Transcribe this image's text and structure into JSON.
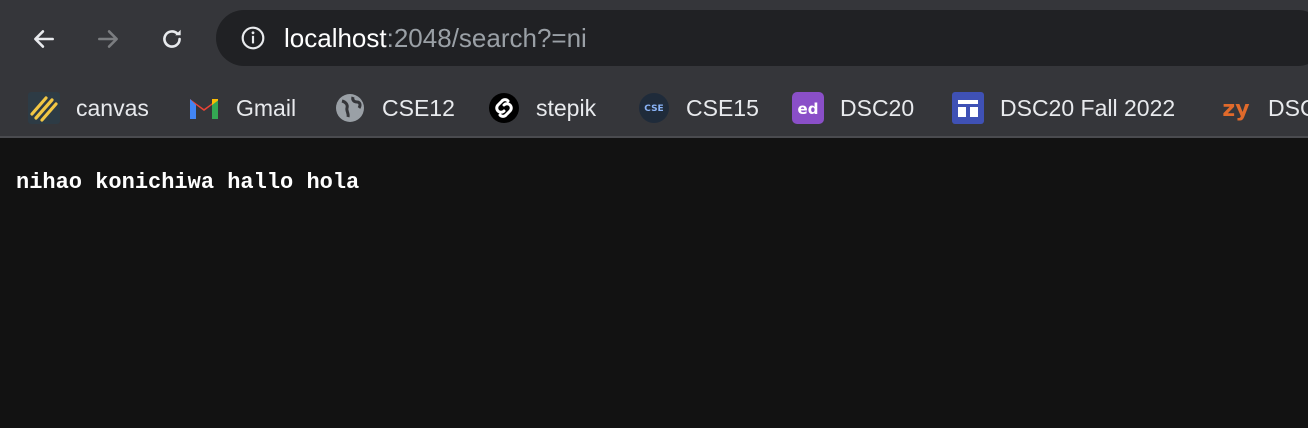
{
  "address_bar": {
    "host": "localhost",
    "rest": ":2048/search?=ni"
  },
  "bookmarks": [
    {
      "label": "canvas",
      "icon": "canvas-icon"
    },
    {
      "label": "Gmail",
      "icon": "gmail-icon"
    },
    {
      "label": "CSE12",
      "icon": "globe-icon"
    },
    {
      "label": "stepik",
      "icon": "stepik-icon"
    },
    {
      "label": "CSE15",
      "icon": "cse-icon"
    },
    {
      "label": "DSC20",
      "icon": "ed-icon"
    },
    {
      "label": "DSC20 Fall 2022",
      "icon": "calendar-icon"
    },
    {
      "label": "DSC",
      "icon": "zybooks-icon"
    }
  ],
  "page": {
    "body_text": "nihao konichiwa hallo hola"
  },
  "colors": {
    "toolbar": "#35363a",
    "omnibox": "#202124",
    "page_bg": "#121212"
  }
}
